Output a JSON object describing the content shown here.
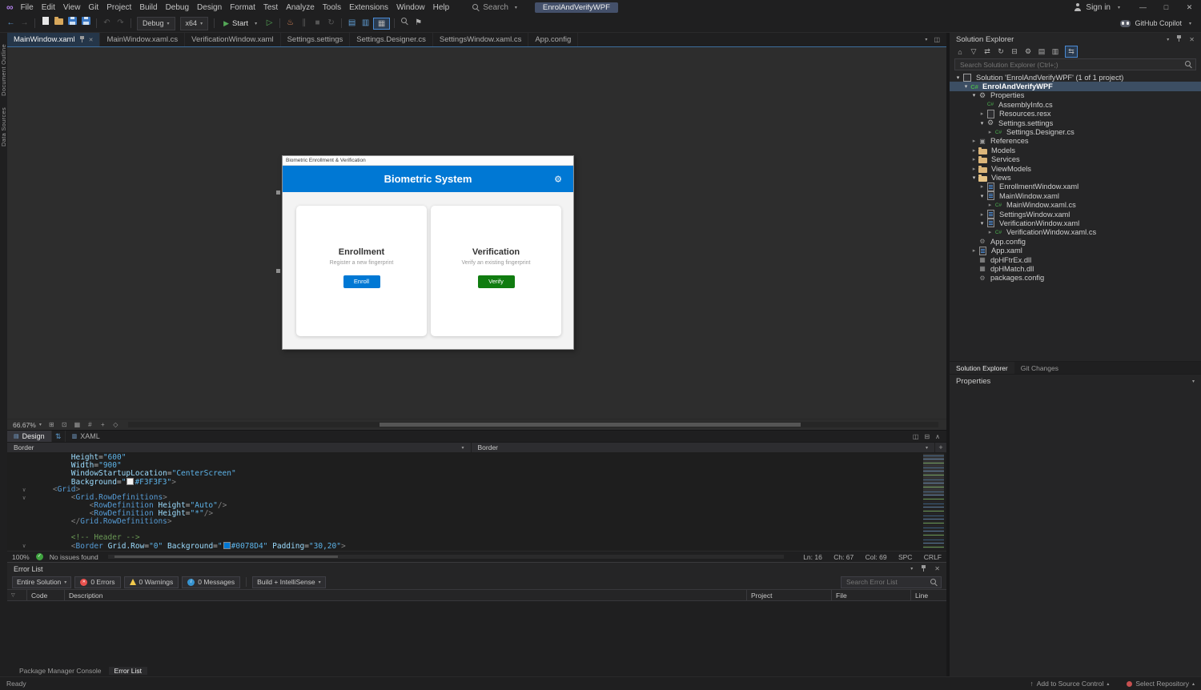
{
  "title_bar": {
    "menus": [
      "File",
      "Edit",
      "View",
      "Git",
      "Project",
      "Build",
      "Debug",
      "Design",
      "Format",
      "Test",
      "Analyze",
      "Tools",
      "Extensions",
      "Window",
      "Help"
    ],
    "search_label": "Search",
    "solution_badge": "EnrolAndVerifyWPF",
    "sign_in_label": "Sign in"
  },
  "toolbar": {
    "configuration": "Debug",
    "platform": "x64",
    "start_label": "Start",
    "copilot_label": "GitHub Copilot"
  },
  "left_strip": {
    "tabs": [
      "Document Outline",
      "Data Sources"
    ]
  },
  "doc_tabs": {
    "tabs": [
      {
        "label": "MainWindow.xaml",
        "active": true
      },
      {
        "label": "MainWindow.xaml.cs"
      },
      {
        "label": "VerificationWindow.xaml"
      },
      {
        "label": "Settings.settings"
      },
      {
        "label": "Settings.Designer.cs"
      },
      {
        "label": "SettingsWindow.xaml.cs"
      },
      {
        "label": "App.config"
      }
    ]
  },
  "designer": {
    "zoom": "66.67%",
    "design_tab": "Design",
    "xaml_tab": "XAML",
    "preview": {
      "window_title": "Biometric Enrollment & Verification",
      "header_title": "Biometric System",
      "header_color": "#0078D4",
      "window_background": "#F3F3F3",
      "cards": [
        {
          "title": "Enrollment",
          "subtitle": "Register a new fingerprint",
          "button_label": "Enroll",
          "button_color": "#0078D4"
        },
        {
          "title": "Verification",
          "subtitle": "Verify an existing fingerprint",
          "button_label": "Verify",
          "button_color": "#107C10"
        }
      ]
    }
  },
  "editor": {
    "breadcrumb_left": "Border",
    "breadcrumb_right": "Border",
    "zoom": "100%",
    "health": "No issues found",
    "ln": "Ln: 16",
    "ch": "Ch: 67",
    "col": "Col: 69",
    "spaces": "SPC",
    "eol": "CRLF",
    "lines": [
      {
        "tokens": [
          {
            "t": "ws",
            "v": "        "
          },
          {
            "t": "attr",
            "v": "Height"
          },
          {
            "t": "op",
            "v": "="
          },
          {
            "t": "str",
            "v": "\"600\""
          }
        ]
      },
      {
        "tokens": [
          {
            "t": "ws",
            "v": "        "
          },
          {
            "t": "attr",
            "v": "Width"
          },
          {
            "t": "op",
            "v": "="
          },
          {
            "t": "str",
            "v": "\"900\""
          }
        ]
      },
      {
        "tokens": [
          {
            "t": "ws",
            "v": "        "
          },
          {
            "t": "attr",
            "v": "WindowStartupLocation"
          },
          {
            "t": "op",
            "v": "="
          },
          {
            "t": "str",
            "v": "\"CenterScreen\""
          }
        ]
      },
      {
        "tokens": [
          {
            "t": "ws",
            "v": "        "
          },
          {
            "t": "attr",
            "v": "Background"
          },
          {
            "t": "op",
            "v": "="
          },
          {
            "t": "str",
            "v": "\""
          },
          {
            "t": "swatch",
            "v": "#F3F3F3"
          },
          {
            "t": "str",
            "v": "#F3F3F3\""
          },
          {
            "t": "delim",
            "v": ">"
          }
        ]
      },
      {
        "fold": true,
        "tokens": [
          {
            "t": "ws",
            "v": "    "
          },
          {
            "t": "delim",
            "v": "<"
          },
          {
            "t": "tag",
            "v": "Grid"
          },
          {
            "t": "delim",
            "v": ">"
          }
        ]
      },
      {
        "fold": true,
        "tokens": [
          {
            "t": "ws",
            "v": "        "
          },
          {
            "t": "delim",
            "v": "<"
          },
          {
            "t": "tag",
            "v": "Grid.RowDefinitions"
          },
          {
            "t": "delim",
            "v": ">"
          }
        ]
      },
      {
        "tokens": [
          {
            "t": "ws",
            "v": "            "
          },
          {
            "t": "delim",
            "v": "<"
          },
          {
            "t": "tag",
            "v": "RowDefinition"
          },
          {
            "t": "ws",
            "v": " "
          },
          {
            "t": "attr",
            "v": "Height"
          },
          {
            "t": "op",
            "v": "="
          },
          {
            "t": "str",
            "v": "\"Auto\""
          },
          {
            "t": "delim",
            "v": "/>"
          }
        ]
      },
      {
        "tokens": [
          {
            "t": "ws",
            "v": "            "
          },
          {
            "t": "delim",
            "v": "<"
          },
          {
            "t": "tag",
            "v": "RowDefinition"
          },
          {
            "t": "ws",
            "v": " "
          },
          {
            "t": "attr",
            "v": "Height"
          },
          {
            "t": "op",
            "v": "="
          },
          {
            "t": "str",
            "v": "\"*\""
          },
          {
            "t": "delim",
            "v": "/>"
          }
        ]
      },
      {
        "tokens": [
          {
            "t": "ws",
            "v": "        "
          },
          {
            "t": "delim",
            "v": "</"
          },
          {
            "t": "tag",
            "v": "Grid.RowDefinitions"
          },
          {
            "t": "delim",
            "v": ">"
          }
        ]
      },
      {
        "tokens": []
      },
      {
        "tokens": [
          {
            "t": "ws",
            "v": "        "
          },
          {
            "t": "com",
            "v": "<!-- Header -->"
          }
        ]
      },
      {
        "fold": true,
        "tokens": [
          {
            "t": "ws",
            "v": "        "
          },
          {
            "t": "delim",
            "v": "<"
          },
          {
            "t": "tag",
            "v": "Border"
          },
          {
            "t": "ws",
            "v": " "
          },
          {
            "t": "attr",
            "v": "Grid.Row"
          },
          {
            "t": "op",
            "v": "="
          },
          {
            "t": "str",
            "v": "\"0\""
          },
          {
            "t": "ws",
            "v": " "
          },
          {
            "t": "attr",
            "v": "Background"
          },
          {
            "t": "op",
            "v": "="
          },
          {
            "t": "str",
            "v": "\""
          },
          {
            "t": "swatch",
            "v": "#0078D4"
          },
          {
            "t": "str",
            "v": "#0078D4\""
          },
          {
            "t": "ws",
            "v": " "
          },
          {
            "t": "attr",
            "v": "Padding"
          },
          {
            "t": "op",
            "v": "="
          },
          {
            "t": "str",
            "v": "\"30,20\""
          },
          {
            "t": "delim",
            "v": ">"
          }
        ]
      }
    ]
  },
  "error_list": {
    "title": "Error List",
    "scope": "Entire Solution",
    "errors_label": "0 Errors",
    "warnings_label": "0 Warnings",
    "messages_label": "0 Messages",
    "filter_label": "Build + IntelliSense",
    "search_placeholder": "Search Error List",
    "columns": {
      "code": "Code",
      "description": "Description",
      "project": "Project",
      "file": "File",
      "line": "Line"
    }
  },
  "bottom_tabs": {
    "package_manager": "Package Manager Console",
    "error_list": "Error List"
  },
  "status_bar": {
    "ready": "Ready",
    "add_to_source_control": "Add to Source Control",
    "select_repository": "Select Repository"
  },
  "solution_explorer": {
    "title": "Solution Explorer",
    "search_placeholder": "Search Solution Explorer (Ctrl+;)",
    "tabs": {
      "solution_explorer": "Solution Explorer",
      "git_changes": "Git Changes"
    },
    "tree": [
      {
        "label": "Solution 'EnrolAndVerifyWPF' (1 of 1 project)"
      },
      {
        "label": "EnrolAndVerifyWPF"
      },
      {
        "label": "Properties"
      },
      {
        "label": "AssemblyInfo.cs"
      },
      {
        "label": "Resources.resx"
      },
      {
        "label": "Settings.settings"
      },
      {
        "label": "Settings.Designer.cs"
      },
      {
        "label": "References"
      },
      {
        "label": "Models"
      },
      {
        "label": "Services"
      },
      {
        "label": "ViewModels"
      },
      {
        "label": "Views"
      },
      {
        "label": "EnrollmentWindow.xaml"
      },
      {
        "label": "MainWindow.xaml"
      },
      {
        "label": "MainWindow.xaml.cs"
      },
      {
        "label": "SettingsWindow.xaml"
      },
      {
        "label": "VerificationWindow.xaml"
      },
      {
        "label": "VerificationWindow.xaml.cs"
      },
      {
        "label": "App.config"
      },
      {
        "label": "App.xaml"
      },
      {
        "label": "dpHFtrEx.dll"
      },
      {
        "label": "dpHMatch.dll"
      },
      {
        "label": "packages.config"
      }
    ]
  },
  "properties_panel": {
    "title": "Properties"
  }
}
